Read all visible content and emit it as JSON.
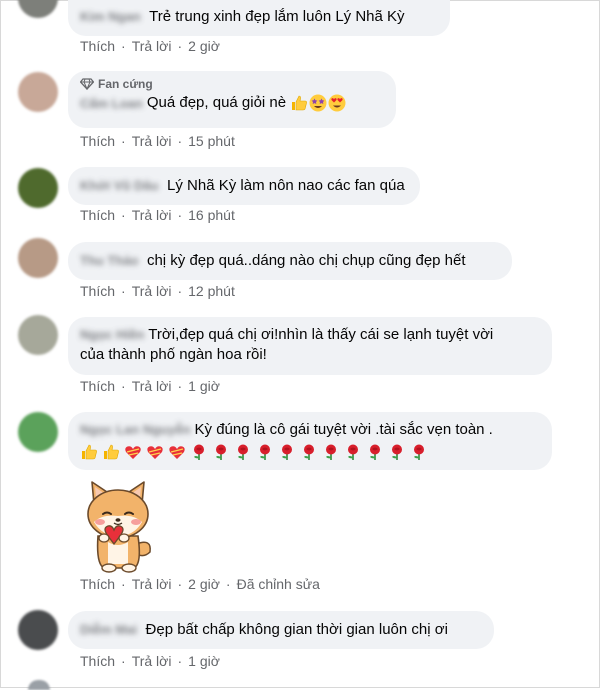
{
  "labels": {
    "like": "Thích",
    "reply": "Trả lời",
    "dot": "·"
  },
  "colors": {
    "bubble": "#f0f2f5",
    "meta": "#65676b",
    "text": "#050505"
  },
  "comments": [
    {
      "author": "Kim Ngan",
      "text": "Trẻ trung xinh đẹp lắm luôn Lý Nhã Kỳ",
      "time": "2 giờ"
    },
    {
      "badge": "Fan cứng",
      "author": "Cẩm Loan",
      "text": "Quá đẹp, quá giỏi nè",
      "time": "15 phút"
    },
    {
      "author": "Khởi Vũ Dâu",
      "text": "Lý Nhã Kỳ làm nôn nao các fan qúa",
      "time": "16 phút"
    },
    {
      "author": "Thu Thảo",
      "text": "chị kỳ đẹp quá..dáng nào chị chụp cũng đẹp hết",
      "time": "12 phút"
    },
    {
      "author": "Ngọc Hiền",
      "text": "Trời,đẹp quá chị ơi!nhìn là thấy cái se lạnh tuyệt vời",
      "text2": "của thành phố ngàn hoa rồi!",
      "time": "1 giờ"
    },
    {
      "author": "Ngọc Lan Nguyễn",
      "text": "Kỳ đúng là cô gái tuyệt vời .tài sắc vẹn toàn .",
      "time": "2 giờ",
      "edited": "Đã chỉnh sửa"
    },
    {
      "author": "Diễm Mai",
      "text": "Đẹp bất chấp không gian thời gian luôn chị ơi",
      "time": "1 giờ"
    }
  ]
}
